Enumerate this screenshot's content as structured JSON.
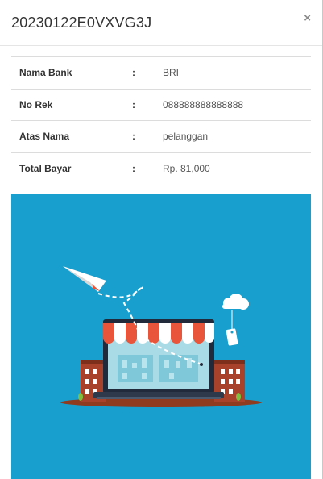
{
  "modal": {
    "title": "20230122E0VXVG3J",
    "close_label": "×"
  },
  "payment_details": [
    {
      "label": "Nama Bank",
      "separator": ":",
      "value": "BRI"
    },
    {
      "label": "No Rek",
      "separator": ":",
      "value": "088888888888888"
    },
    {
      "label": "Atas Nama",
      "separator": ":",
      "value": "pelanggan"
    },
    {
      "label": "Total Bayar",
      "separator": ":",
      "value": "Rp. 81,000"
    }
  ],
  "illustration": {
    "icon": "online-store-icon",
    "background_color": "#189fcd"
  }
}
